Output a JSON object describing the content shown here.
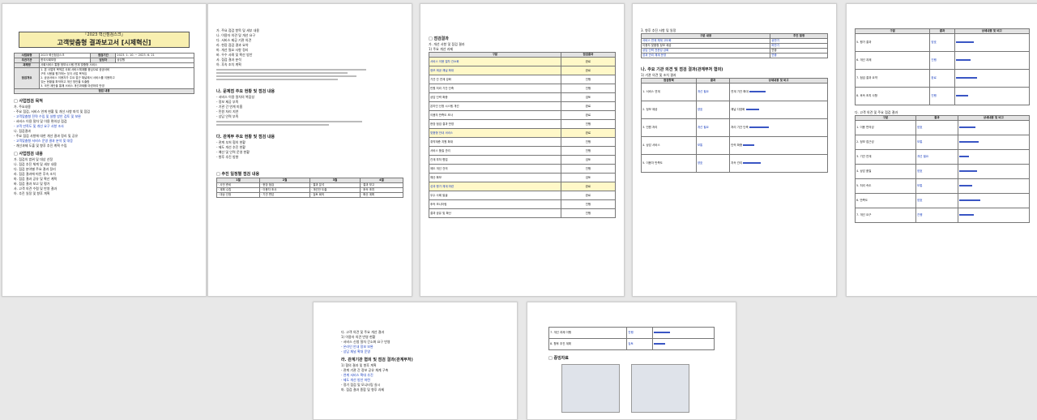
{
  "page1": {
    "title_sub": "「2023 혁신점검스크」",
    "title_main": "고객맞춤형 결과보고서 [시제혁신]",
    "info": [
      {
        "k": "사업유형",
        "v": "2023 혁신점검스크",
        "k2": "점검기간",
        "v2": "2023. 1. 10. ~ 2023. 6. 21"
      },
      {
        "k": "주관기관",
        "v": "한국사회보장",
        "k2": "담당자",
        "v2": "상담원"
      },
      {
        "k": "과제명",
        "v": "사회서비스 통합 정보시스템 연계 맞춤형 서비스",
        "k2": "",
        "v2": ""
      }
    ],
    "summary_label": "점검개요",
    "summary_lines": [
      "1. 본 사업의 목적은 사회 서비스체계를 중심으로 공공서비",
      "   구의 사용을 평가하는 것이 사업 목적임",
      "2. 공공서비스 이용자가 주요 접근 채널에서 서비스를 이용하고",
      "   있는 현황을 파악하고 개선 방안을 도출함",
      "3. 국민 제안을 통해 서비스 개선과제를 마련하여 반영"
    ],
    "summary_foot": "점검 내용",
    "s1_title": "□ 사업점검 목적",
    "s1_sub": "가. 주요내용",
    "s1_lines": [
      "- 주요 점검, 서비스 연계 현황 및 개선 사항 파악 및 점검",
      "- 고객맞춤형 전략 수립 및 실행 방안 검토 및 보완",
      "- 서비스 이용 절차 및 이용 편의성 점검",
      "- 고객 만족도 및 개선 요구 사항 조사"
    ],
    "s1_sub2": "나. 점검결과",
    "s1_lines2": [
      "- 주요 점검 사항에 대한 개선 결과 정리 및 공유",
      "- 고객맞춤형 서비스 운영 결과 분석 및 대응",
      "- 개선과제 도출 및 향후 추진 계획 수립"
    ],
    "s2_title": "□ 사업점검 내용",
    "s2_lines": [
      "가. 점검의 범위 및 대상 선정",
      "나. 점검 추진 체계 및 세부 내용",
      "다. 점검 분야별 주요 결과 정리",
      "라. 점검 결과에 따른 후속 조치",
      "마. 점검 결과 공유 및 확산 계획",
      "바. 점검 결과 보고 및 평가",
      "사. 고객 의견 수렴 및 반영 결과",
      "아. 추진 일정 및 향후 계획"
    ]
  },
  "page2": {
    "top_lines": [
      "가. 주요 점검 항목 및 세부 내용",
      "나. 이용자 의견 및 개선 요구",
      "다. 서비스 제공 기관 의견",
      "라. 현장 점검 결과 요약",
      "마. 개선 필요 사항 정리",
      "바. 우수 사례 및 확산 방안",
      "사. 점검 결과 분석",
      "아. 후속 조치 계획"
    ],
    "sec_a": "나. 문제점 주요 현황 및 점검 내용",
    "sec_a_lines": [
      "- 서비스 이용 절차의 복잡성",
      "- 정보 제공 부족",
      "- 기관 간 연계 미흡",
      "- 민원 처리 지연",
      "- 상담 인력 부족"
    ],
    "sec_b": "다. 관계부 주요 현황 및 점검 내용",
    "sec_b_lines": [
      "- 관계 부처 협의 현황",
      "- 제도 개선 추진 현황",
      "- 예산 및 인력 운영 현황",
      "- 향후 추진 방향"
    ],
    "sec_c": "□ 추진 일정별 점검 내용",
    "sched_head": [
      "1월",
      "2월",
      "3월",
      "4월"
    ],
    "sched_rows": [
      [
        "· 사전 준비",
        "· 현장 점검",
        "· 결과 분석",
        "· 결과 보고"
      ],
      [
        "· 계획 수립",
        "· 이용자 조사",
        "· 개선안 도출",
        "· 후속 조치"
      ],
      [
        "· 대상 선정",
        "· 기관 면담",
        "· 검토 회의",
        "· 확산 계획"
      ]
    ]
  },
  "page3": {
    "sec": "□ 점검결과",
    "sub": "가. 개선 사항 및 점검 결과",
    "sub2": "1) 주요 개선 과제",
    "head": [
      "구분",
      "점검결과"
    ],
    "rows": [
      {
        "a": "서비스 이용 절차 간소화",
        "b": "완료",
        "hl": true
      },
      {
        "a": "정보 제공 채널 확대",
        "b": "완료",
        "hl": true
      },
      {
        "a": "기관 간 연계 강화",
        "b": "진행",
        "hl": false
      },
      {
        "a": "민원 처리 기간 단축",
        "b": "진행",
        "hl": false
      },
      {
        "a": "상담 인력 확충",
        "b": "검토",
        "hl": false
      },
      {
        "a": "온라인 신청 시스템 개선",
        "b": "완료",
        "hl": false
      },
      {
        "a": "이용자 만족도 조사",
        "b": "완료",
        "hl": false
      },
      {
        "a": "현장 점검 결과 반영",
        "b": "진행",
        "hl": false
      },
      {
        "a": "맞춤형 안내 서비스",
        "b": "완료",
        "hl": true
      },
      {
        "a": "취약계층 지원 확대",
        "b": "진행",
        "hl": false
      },
      {
        "a": "서비스 품질 관리",
        "b": "진행",
        "hl": false
      },
      {
        "a": "관계 부처 협업",
        "b": "검토",
        "hl": false
      },
      {
        "a": "제도 개선 건의",
        "b": "진행",
        "hl": false
      },
      {
        "a": "예산 확보",
        "b": "검토",
        "hl": false
      },
      {
        "a": "성과 평가 체계 마련",
        "b": "완료",
        "hl": true
      },
      {
        "a": "우수 사례 발굴",
        "b": "완료",
        "hl": false
      },
      {
        "a": "후속 모니터링",
        "b": "진행",
        "hl": false
      },
      {
        "a": "결과 공유 및 확산",
        "b": "진행",
        "hl": false
      }
    ]
  },
  "page4": {
    "sub": "3. 향후 추진 사항 및 일정",
    "head": [
      "구분 내용",
      "추진 일정"
    ],
    "rows": [
      [
        "서비스 연계 체계 고도화",
        "상반기"
      ],
      [
        "이용자 맞춤형 정보 제공",
        "하반기"
      ],
      [
        "상담 인력 전문성 강화",
        "연중"
      ],
      [
        "성과 관리 체계 운영",
        "연중"
      ]
    ],
    "sec2": "나. 주요 기관 의견 및 점검 결과(관계부처 협의)",
    "sec2_sub": "1) 기관 의견 및 조치 결과",
    "head2": [
      "점검항목",
      "결과",
      "상세내용 및 비고"
    ],
    "rows2": [
      [
        "1. 서비스 연계",
        "개선 필요",
        "연계 기관 확대"
      ],
      [
        "2. 정보 제공",
        "양호",
        "채널 다양화"
      ],
      [
        "3. 민원 처리",
        "개선 필요",
        "처리 기간 단축"
      ],
      [
        "4. 상담 서비스",
        "보통",
        "인력 확충"
      ],
      [
        "5. 이용자 만족도",
        "양호",
        "지속 관리"
      ]
    ]
  },
  "page5": {
    "head": [
      "구분",
      "결과",
      "상세내용 및 비고"
    ],
    "rows_top": [
      [
        "5. 평가 결과",
        "양호",
        ""
      ],
      [
        "6. 개선 과제",
        "진행",
        ""
      ],
      [
        "7. 점검 결과 요약",
        "완료",
        ""
      ],
      [
        "8. 후속 조치 사항",
        "진행",
        ""
      ]
    ],
    "sec2": "다. 고객 의견 및 주요 점검 결과",
    "rows_bottom": [
      [
        "1. 이용 편의성",
        "양호",
        ""
      ],
      [
        "2. 정보 접근성",
        "보통",
        ""
      ],
      [
        "3. 기관 연계",
        "개선 필요",
        ""
      ],
      [
        "4. 상담 품질",
        "양호",
        ""
      ],
      [
        "5. 처리 속도",
        "보통",
        ""
      ],
      [
        "6. 만족도",
        "양호",
        ""
      ],
      [
        "7. 개선 요구",
        "진행",
        ""
      ]
    ]
  },
  "page6": {
    "lines": [
      "다. 고객 의견 및 주요 개선 결과",
      "1) 이용자 의견 반영 현황",
      "- 서비스 신청 절차 간소화 요구 반영",
      "- 온라인 안내 정보 보완",
      "- 상담 채널 확대 운영",
      "라. 관계기관 협의 및 점검 결과(관계부처)",
      "1) 협의 결과 및 향후 계획",
      "- 관계 기관 간 정보 공유 체계 구축",
      "- 연계 서비스 확대 추진",
      "- 제도 개선 방안 마련",
      "- 정기 점검 및 모니터링 실시",
      "마. 점검 결과 종합 및 향후 과제"
    ]
  },
  "page7": {
    "rows": [
      [
        "7. 개선 과제 이행",
        "진행"
      ],
      [
        "8. 향후 추진 계획",
        "검토"
      ]
    ],
    "sec": "□ 증빙자료"
  }
}
